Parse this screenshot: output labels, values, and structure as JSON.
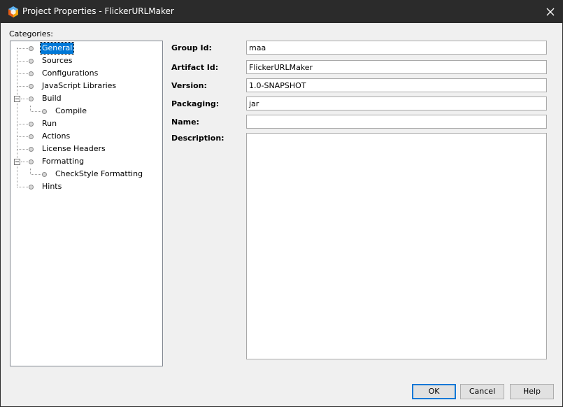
{
  "window": {
    "title": "Project Properties - FlickerURLMaker",
    "close_label": "✕"
  },
  "categories": {
    "label": "Categories:",
    "items": [
      {
        "label": "General",
        "selected": true
      },
      {
        "label": "Sources"
      },
      {
        "label": "Configurations"
      },
      {
        "label": "JavaScript Libraries"
      },
      {
        "label": "Build",
        "expanded": true
      },
      {
        "label": "Compile"
      },
      {
        "label": "Run"
      },
      {
        "label": "Actions"
      },
      {
        "label": "License Headers"
      },
      {
        "label": "Formatting",
        "expanded": true
      },
      {
        "label": "CheckStyle Formatting"
      },
      {
        "label": "Hints"
      }
    ]
  },
  "form": {
    "group_id": {
      "label": "Group Id:",
      "value": "maa"
    },
    "artifact_id": {
      "label": "Artifact Id:",
      "value": "FlickerURLMaker"
    },
    "version": {
      "label": "Version:",
      "value": "1.0-SNAPSHOT"
    },
    "packaging": {
      "label": "Packaging:",
      "value": "jar"
    },
    "name": {
      "label": "Name:",
      "value": ""
    },
    "description": {
      "label": "Description:",
      "value": ""
    }
  },
  "buttons": {
    "ok": "OK",
    "cancel": "Cancel",
    "help": "Help"
  },
  "colors": {
    "titlebar": "#2b2b2b",
    "selection": "#0078d7",
    "dialog_bg": "#f0f0f0"
  }
}
